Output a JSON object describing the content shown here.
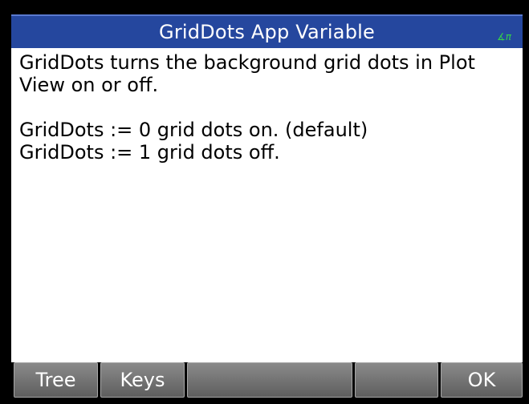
{
  "header": {
    "title": "GridDots App Variable",
    "angle_indicator": "∡π"
  },
  "help": {
    "lines": [
      "GridDots turns the background grid dots in Plot",
      "View on or off.",
      "",
      "GridDots := 0 grid dots on. (default)",
      "GridDots := 1 grid dots off."
    ]
  },
  "menu": {
    "keys": [
      "Tree",
      "Keys",
      "",
      "",
      "OK"
    ]
  },
  "colors": {
    "titlebar": "#25479e",
    "angle_indicator": "#35d04a",
    "softkey": "#6f6f6f"
  }
}
